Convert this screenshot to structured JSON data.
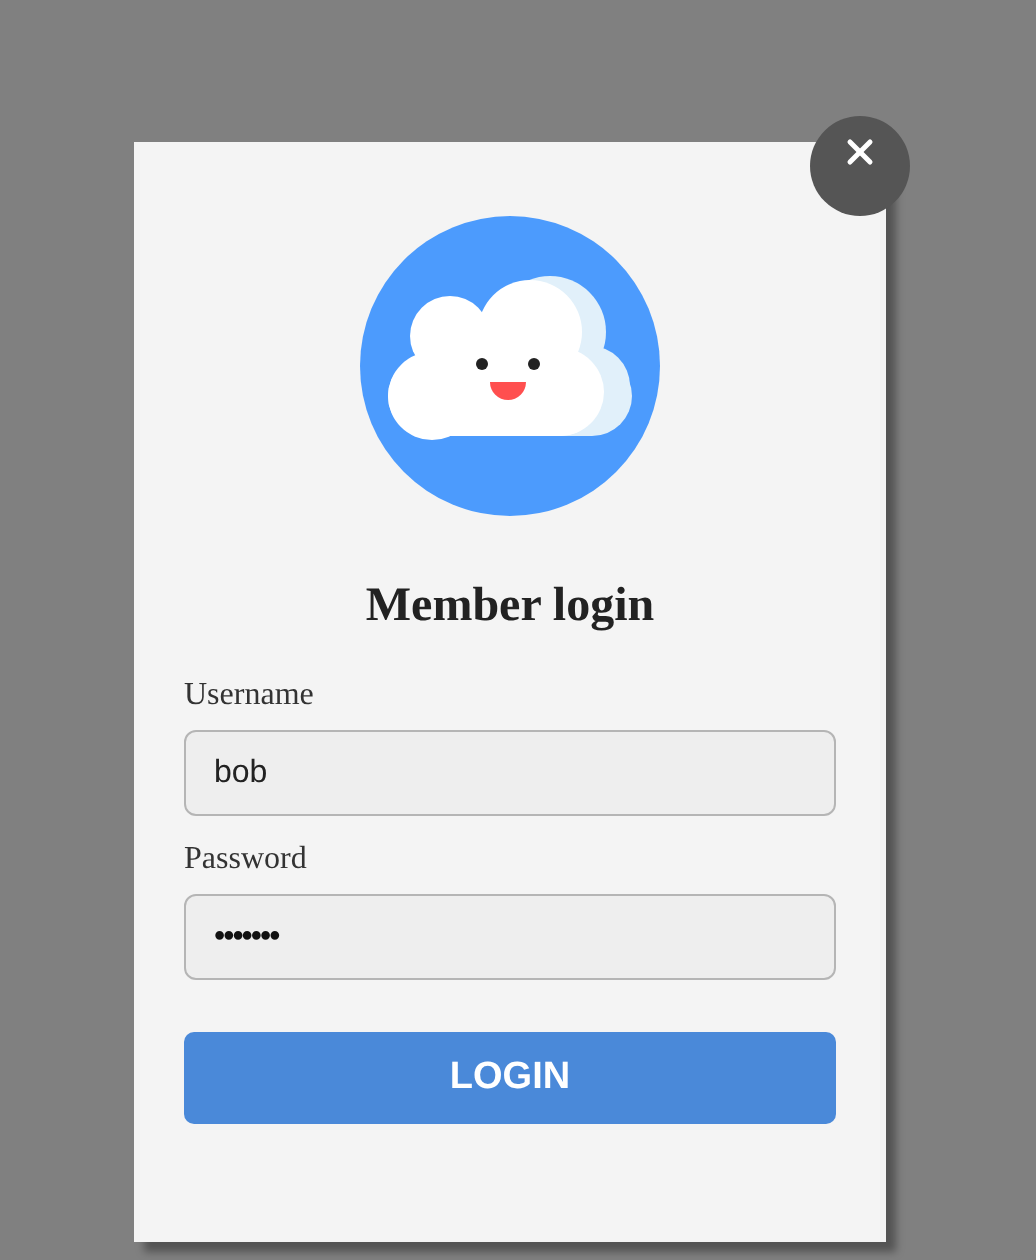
{
  "dialog": {
    "title": "Member login",
    "fields": [
      {
        "label": "Username",
        "value": "bob",
        "kind": "text"
      },
      {
        "label": "Password",
        "value": "•••••••",
        "kind": "password"
      }
    ],
    "submit": "LOGIN"
  }
}
